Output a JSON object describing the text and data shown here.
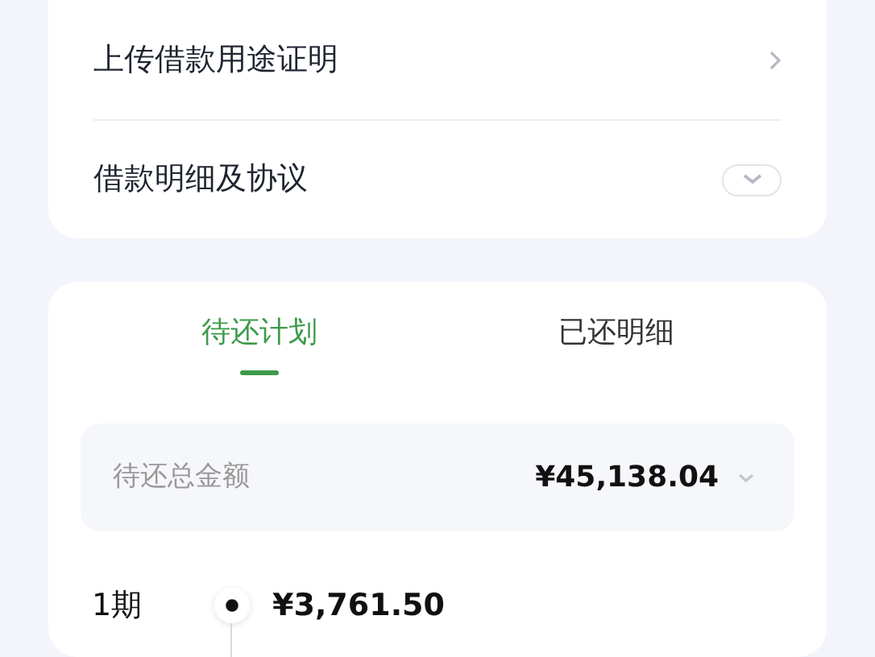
{
  "loan_card": {
    "rows": [
      {
        "kind": "link",
        "label": "上传借款用途证明"
      },
      {
        "kind": "toggle",
        "label": "借款明细及协议",
        "expanded": false
      }
    ]
  },
  "tabs": [
    {
      "label": "待还计划",
      "selected": true
    },
    {
      "label": "已还明细",
      "selected": false
    }
  ],
  "total": {
    "label": "待还总金额",
    "amount": "¥45,138.04"
  },
  "installments": [
    {
      "period": "1期",
      "amount": "¥3,761.50"
    }
  ]
}
